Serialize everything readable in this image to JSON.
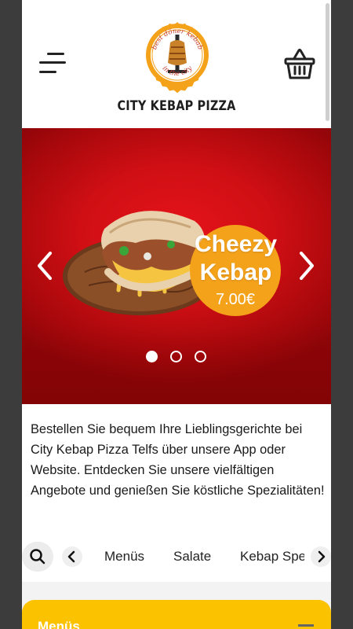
{
  "header": {
    "brand_name": "CITY KEBAP PIZZA",
    "logo_text_top": "best döner kebab",
    "logo_text_bottom": "in the city",
    "menu_icon": "hamburger-menu-icon",
    "cart_icon": "shopping-basket-icon"
  },
  "slider": {
    "promo_title_line1": "Cheezy",
    "promo_title_line2": "Kebap",
    "promo_price": "7.00€",
    "slide_count": 3,
    "active_slide": 1,
    "prev_icon": "chevron-left-icon",
    "next_icon": "chevron-right-icon"
  },
  "intro": {
    "text": "Bestellen Sie bequem Ihre Lieblingsgerichte bei City Kebap Pizza Telfs über unsere App oder Website. Entdecken Sie unsere vielfältigen Angebote und genießen Sie köstliche Spezialitäten!"
  },
  "categories": {
    "search_icon": "search-icon",
    "prev_icon": "chevron-left-icon",
    "next_icon": "chevron-right-icon",
    "items": [
      "Menüs",
      "Salate",
      "Kebap Spezialitäten"
    ]
  },
  "section": {
    "title": "Menüs",
    "collapse_icon": "minus-icon"
  },
  "colors": {
    "brand_orange": "#f5a21b",
    "hero_red": "#d4121a",
    "section_yellow": "#fbc200"
  }
}
